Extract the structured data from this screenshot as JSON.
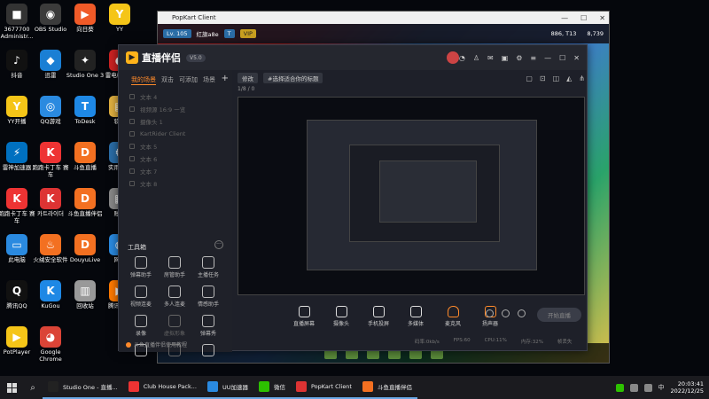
{
  "desktop": {
    "icons": [
      {
        "label": "3677700 Administr...",
        "glyph": "■",
        "color": "#333"
      },
      {
        "label": "OBS Studio",
        "glyph": "◉",
        "color": "#3b3b3b"
      },
      {
        "label": "向日葵",
        "glyph": "▶",
        "color": "#f05a28"
      },
      {
        "label": "YY",
        "glyph": "Y",
        "color": "#f5c518"
      },
      {
        "label": "抖音",
        "glyph": "♪",
        "color": "#111"
      },
      {
        "label": "迅雷",
        "glyph": "◆",
        "color": "#1a7fd4"
      },
      {
        "label": "Studio One 3",
        "glyph": "✦",
        "color": "#222"
      },
      {
        "label": "雷电模拟器",
        "glyph": "●",
        "color": "#c22"
      },
      {
        "label": "YY开播",
        "glyph": "Y",
        "color": "#f5c518"
      },
      {
        "label": "QQ游戏",
        "glyph": "◎",
        "color": "#2a8ae0"
      },
      {
        "label": "ToDesk",
        "glyph": "T",
        "color": "#1e88e5"
      },
      {
        "label": "软件",
        "glyph": "▤",
        "color": "#e0b040"
      },
      {
        "label": "雷神加速器",
        "glyph": "⚡",
        "color": "#0070c0"
      },
      {
        "label": "跑跑卡丁车 赛车",
        "glyph": "K",
        "color": "#e33"
      },
      {
        "label": "斗鱼直播",
        "glyph": "D",
        "color": "#f37021"
      },
      {
        "label": "实用工具",
        "glyph": "⚙",
        "color": "#2b6ea8"
      },
      {
        "label": "跑跑卡丁车 赛车",
        "glyph": "K",
        "color": "#e33"
      },
      {
        "label": "카트라이더",
        "glyph": "K",
        "color": "#d33"
      },
      {
        "label": "斗鱼直播伴侣",
        "glyph": "D",
        "color": "#f37021"
      },
      {
        "label": "账号",
        "glyph": "▦",
        "color": "#888"
      },
      {
        "label": "此电脑",
        "glyph": "▭",
        "color": "#2a8ae0"
      },
      {
        "label": "火绒安全软件",
        "glyph": "♨",
        "color": "#f37021"
      },
      {
        "label": "DouyuLive",
        "glyph": "D",
        "color": "#f37021"
      },
      {
        "label": "网络",
        "glyph": "◍",
        "color": "#2a8ae0"
      },
      {
        "label": "腾讯QQ",
        "glyph": "Q",
        "color": "#111"
      },
      {
        "label": "KuGou",
        "glyph": "K",
        "color": "#1e88e5"
      },
      {
        "label": "回收站",
        "glyph": "▥",
        "color": "#999"
      },
      {
        "label": "腾讯视频",
        "glyph": "▶",
        "color": "#ff7a00"
      },
      {
        "label": "PotPlayer",
        "glyph": "▶",
        "color": "#f5c518"
      },
      {
        "label": "Google Chrome",
        "glyph": "◕",
        "color": "#db4437"
      }
    ]
  },
  "popkart": {
    "title": "PopKart Client",
    "level": "Lv. 105",
    "player": "红旗a8e",
    "badge_t": "T",
    "vip": "VIP",
    "coins1": "886, T13",
    "coins2": "8,739"
  },
  "app": {
    "name": "直播伴侣",
    "version": "V5.0",
    "scene_tabs": [
      "我的场景",
      "双击",
      "可添加",
      "场景"
    ],
    "scenes": [
      "文本 4",
      "视频源 16:9 一览",
      "摄像头 1",
      "KartRider Client",
      "文本 5",
      "文本 6",
      "文本 7",
      "文本 8"
    ],
    "tools_title": "工具箱",
    "tools": [
      {
        "label": "弹幕助手",
        "dim": false
      },
      {
        "label": "房管助手",
        "dim": false
      },
      {
        "label": "主播任务",
        "dim": false
      },
      {
        "label": "视频连麦",
        "dim": false
      },
      {
        "label": "多人连麦",
        "dim": false
      },
      {
        "label": "情感助手",
        "dim": false
      },
      {
        "label": "录像",
        "dim": false
      },
      {
        "label": "虚拟形象",
        "dim": true
      },
      {
        "label": "弹幕秀",
        "dim": false
      },
      {
        "label": "",
        "dim": false
      },
      {
        "label": "",
        "dim": true
      },
      {
        "label": "",
        "dim": false
      }
    ],
    "left_footer": "斗鱼直播伴侣使用教程",
    "edit_label": "修改",
    "title_placeholder": "#选择适合你的标题",
    "preview_sub": "1/8  /  0",
    "controls": [
      {
        "label": "直播屏幕",
        "type": ""
      },
      {
        "label": "摄像头",
        "type": ""
      },
      {
        "label": "手机投屏",
        "type": ""
      },
      {
        "label": "多媒体",
        "type": ""
      },
      {
        "label": "麦克风",
        "type": "mic"
      },
      {
        "label": "扬声器",
        "type": "spk"
      }
    ],
    "start_label": "开始直播",
    "status": [
      "码率:0kb/s",
      "FPS:60",
      "CPU:11%",
      "内存:32%",
      "帧丢失"
    ]
  },
  "taskbar": {
    "apps": [
      {
        "label": "Studio One - 直播...",
        "color": "#222"
      },
      {
        "label": "Club House Pack...",
        "color": "#e33"
      },
      {
        "label": "UU加速器",
        "color": "#2a8ae0"
      },
      {
        "label": "微信",
        "color": "#2dc100"
      },
      {
        "label": "PopKart Client",
        "color": "#d33"
      },
      {
        "label": "斗鱼直播伴侣",
        "color": "#f37021"
      }
    ],
    "time": "20:03:41",
    "date": "2022/12/25"
  }
}
